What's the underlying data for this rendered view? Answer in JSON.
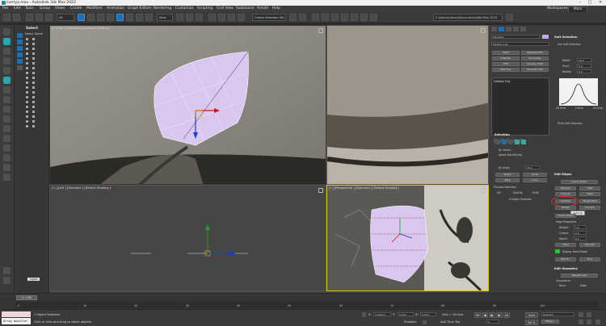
{
  "titlebar": {
    "title": "inertya.max - Autodesk 3ds Max 2023",
    "minimize": "–",
    "maximize": "□",
    "close": "✕"
  },
  "menu": [
    "File",
    "Edit",
    "Tools",
    "Group",
    "Views",
    "Create",
    "Modifiers",
    "Animation",
    "Graph Editors",
    "Rendering",
    "Customize",
    "Scripting",
    "Civil View",
    "Substance",
    "Arnold",
    "Help"
  ],
  "menu_right": {
    "workspaces_label": "Workspaces:",
    "workspace": "Main"
  },
  "toolbar": {
    "selection_set": "Create Selection Set",
    "project_path": "C:\\Users\\Owner\\Documents\\3ds Max 2023"
  },
  "scene_explorer": {
    "title": "Select",
    "column_header": "Name (Sorte",
    "layer_button": "Layer"
  },
  "viewports": {
    "top": "[+] [Top ] [Standard ] [Default Shading ]",
    "left": "[+] [Left ] [Standard ] [Default Shading ]",
    "persp": "[+] [Perspective ] [Standard ] [Default Shading ]"
  },
  "modifier_panel": {
    "object_name": "Plane001",
    "modifier_list": "Modifier List",
    "btns": [
      "Shell",
      "MeshSmooth",
      "Chamfer",
      "Symmetry",
      "FFD",
      "Unwrap UVW",
      "Edit Poly",
      "TurboSmooth"
    ],
    "stack_item": "Editable Poly",
    "selection_header": "Selection",
    "by_vertex": "By Vertex",
    "ignore_backfacing": "Ignore Backfacing",
    "by_angle": "By Angle",
    "angle_value": "45.0",
    "shrink": "Shrink",
    "grow": "Grow",
    "ring": "Ring",
    "loop": "Loop",
    "preview_label": "Preview Selection",
    "preview_off": "Off",
    "preview_subobj": "SubObj",
    "preview_multi": "Multi",
    "selected_status": "0 Edges Selected",
    "soft_selection": "Soft Selection",
    "use_soft": "Use Soft Selection",
    "falloff_label": "Falloff",
    "falloff": "20.0",
    "pinch_label": "Pinch",
    "pinch": "0.0",
    "bubble_label": "Bubble",
    "bubble": "0.0",
    "curve_labels": [
      "20.0cm",
      "0.0cm",
      "20.0cm"
    ],
    "paint_soft": "Paint Soft Selection",
    "edit_edges": "Edit Edges",
    "insert_vertex": "Insert Vertex",
    "remove": "Remove",
    "split": "Split",
    "extrude": "Extrude",
    "weld": "Weld",
    "chamfer": "Chamfer",
    "target_weld": "Target Weld",
    "bridge": "Bridge",
    "connect": "Connect",
    "settings_popup": "Settings",
    "create_shape": "Create Shape",
    "edge_properties": "Edge Properties",
    "weight_label": "Weight:",
    "weight": "1.0",
    "crease_label": "Crease:",
    "crease": "0.0",
    "depth_label": "Depth:",
    "depth": "0.0",
    "hard": "Hard",
    "smooth": "Smooth",
    "display_hard": "Display Hard Edges",
    "edit_tri": "Edit Tri.",
    "turn": "Turn",
    "edit_geometry": "Edit Geometry",
    "repeat_last": "Repeat Last",
    "constraints": "Constraints",
    "none": "None",
    "edge": "Edge"
  },
  "timeline": {
    "frame_display": "0 / 100",
    "ticks": [
      "0",
      "10",
      "20",
      "30",
      "40",
      "50",
      "60",
      "70",
      "80",
      "90",
      "100"
    ]
  },
  "status": {
    "maxscript": "Array modifier",
    "objects": "1 Object Selected",
    "hint": "Click or click-and-drag to select objects",
    "x_label": "X:",
    "x_value": "1.526cm",
    "y_label": "Y:",
    "y_value": "0.0cm",
    "z_label": "Z:",
    "z_value": "0.0cm",
    "grid": "Grid = 10.0cm",
    "enabled": "Enabled:",
    "add_time_tag": "Add Time Tag",
    "auto": "Auto",
    "selected": "Selected",
    "set_key": "Set K.",
    "filters": "Filters...",
    "frame": "0"
  },
  "colors": {
    "accent": "#1f6fb2",
    "plane_fill": "#d9c7f0",
    "persp_border": "#e8c300",
    "highlight_circle": "#e03030"
  }
}
